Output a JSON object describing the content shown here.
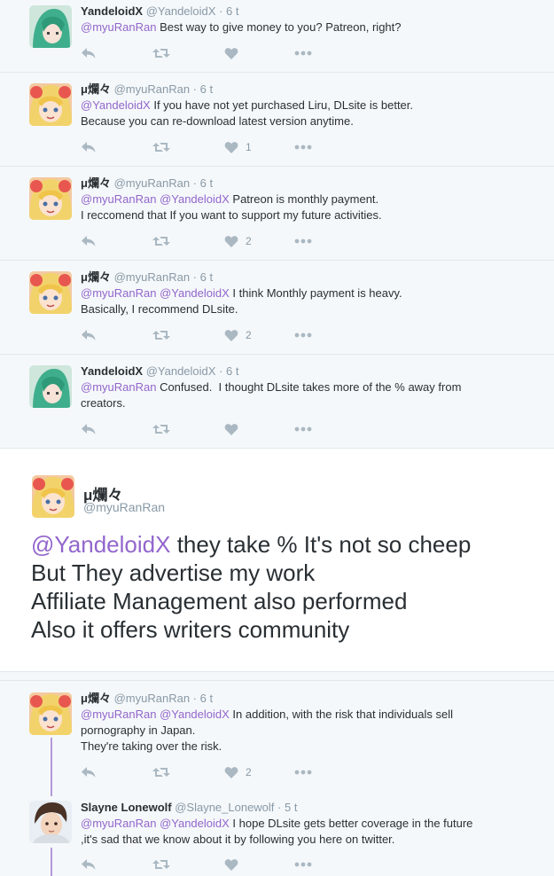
{
  "tweets": [
    {
      "name": "YandeloidX",
      "handle": "@YandeloidX",
      "dot": "·",
      "time": "6 t",
      "mentions": "@myuRanRan",
      "body": " Best way to give money to you? Patreon, right?",
      "like_count": "",
      "avatar": "green-hair"
    },
    {
      "name": "μ爛々",
      "handle": "@myuRanRan",
      "dot": "·",
      "time": "6 t",
      "mentions": "@YandeloidX",
      "body": " If you have not yet purchased Liru, DLsite is better.\nBecause you can re-download latest version anytime.",
      "like_count": "1",
      "avatar": "blonde"
    },
    {
      "name": "μ爛々",
      "handle": "@myuRanRan",
      "dot": "·",
      "time": "6 t",
      "mentions": "@myuRanRan @YandeloidX",
      "body": " Patreon is monthly payment.\nI reccomend that If you want to support my future activities.",
      "like_count": "2",
      "avatar": "blonde"
    },
    {
      "name": "μ爛々",
      "handle": "@myuRanRan",
      "dot": "·",
      "time": "6 t",
      "mentions": "@myuRanRan @YandeloidX",
      "body": " I think Monthly payment is heavy.\nBasically, I recommend DLsite.",
      "like_count": "2",
      "avatar": "blonde"
    },
    {
      "name": "YandeloidX",
      "handle": "@YandeloidX",
      "dot": "·",
      "time": "6 t",
      "mentions": "@myuRanRan",
      "body": " Confused.  I thought DLsite takes more of the % away from\ncreators.",
      "like_count": "",
      "avatar": "green-hair"
    }
  ],
  "expanded": {
    "name": "μ爛々",
    "handle": "@myuRanRan",
    "mention": "@YandeloidX",
    "line1": " they take % It's not so cheep",
    "line2": "But They advertise my work",
    "line3": "Affiliate Management also performed",
    "line4": "Also it offers writers community"
  },
  "replies": [
    {
      "name": "μ爛々",
      "handle": "@myuRanRan",
      "dot": "·",
      "time": "6 t",
      "mentions": "@myuRanRan @YandeloidX",
      "body": " In addition, with the risk that individuals sell\npornography in Japan.\nThey're taking over the risk.",
      "like_count": "2",
      "avatar": "blonde"
    },
    {
      "name": "Slayne Lonewolf",
      "handle": "@Slayne_Lonewolf",
      "dot": "·",
      "time": "5 t",
      "mentions": "@myuRanRan @YandeloidX",
      "body": " I hope DLsite gets better coverage in the future\n,it's sad that we know about it by following you here on twitter.",
      "like_count": "",
      "avatar": "brown-hair"
    }
  ],
  "colors": {
    "link": "#9266cc",
    "thread_line": "#b49ad8",
    "icon": "#aab8c2"
  },
  "icons": [
    "reply-icon",
    "retweet-icon",
    "like-icon",
    "more-icon"
  ]
}
